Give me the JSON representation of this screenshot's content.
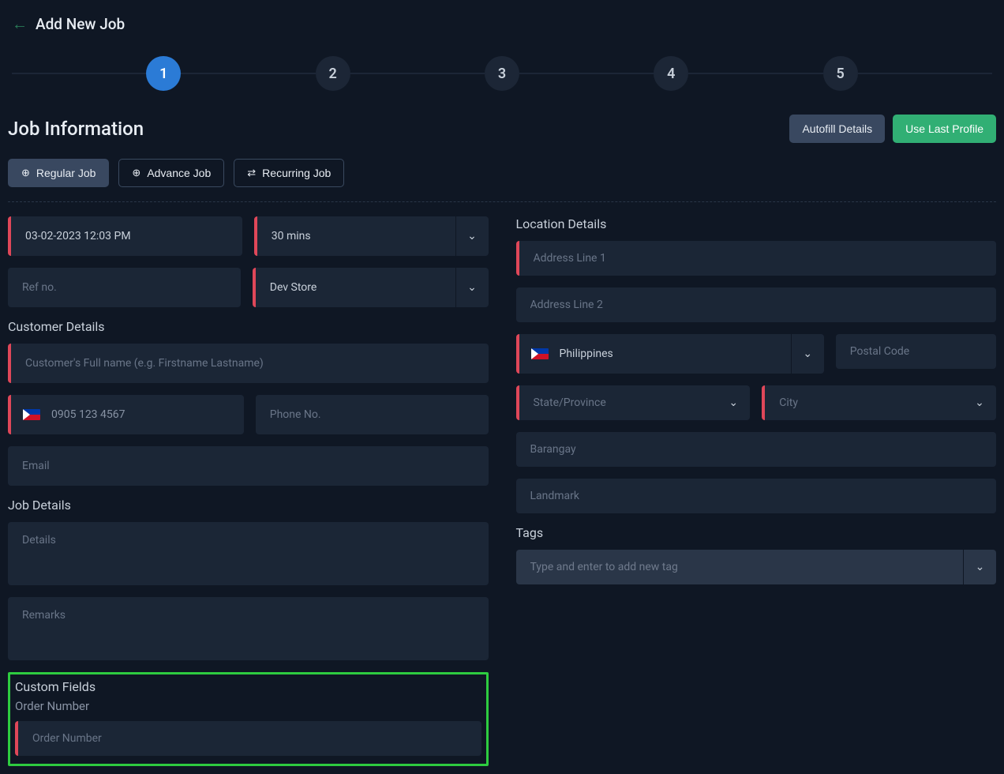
{
  "header": {
    "title": "Add New Job"
  },
  "stepper": {
    "steps": [
      "1",
      "2",
      "3",
      "4",
      "5"
    ],
    "active_index": 0
  },
  "section": {
    "title": "Job Information",
    "autofill_btn": "Autofill Details",
    "last_profile_btn": "Use Last Profile"
  },
  "job_types": {
    "regular": "Regular Job",
    "advance": "Advance Job",
    "recurring": "Recurring Job"
  },
  "left": {
    "datetime": "03-02-2023 12:03 PM",
    "duration": "30 mins",
    "ref_no_placeholder": "Ref no.",
    "store": "Dev Store",
    "customer_details_title": "Customer Details",
    "customer_name_placeholder": "Customer's Full name (e.g. Firstname Lastname)",
    "mobile_placeholder": "0905 123 4567",
    "phone_placeholder": "Phone No.",
    "email_placeholder": "Email",
    "job_details_title": "Job Details",
    "details_placeholder": "Details",
    "remarks_placeholder": "Remarks",
    "custom_fields_title": "Custom Fields",
    "order_number_label": "Order Number",
    "order_number_placeholder": "Order Number"
  },
  "right": {
    "location_details_title": "Location Details",
    "address1_placeholder": "Address Line 1",
    "address2_placeholder": "Address Line 2",
    "country": "Philippines",
    "postal_placeholder": "Postal Code",
    "state_placeholder": "State/Province",
    "city_placeholder": "City",
    "barangay_placeholder": "Barangay",
    "landmark_placeholder": "Landmark",
    "tags_title": "Tags",
    "tags_placeholder": "Type and enter to add new tag"
  }
}
